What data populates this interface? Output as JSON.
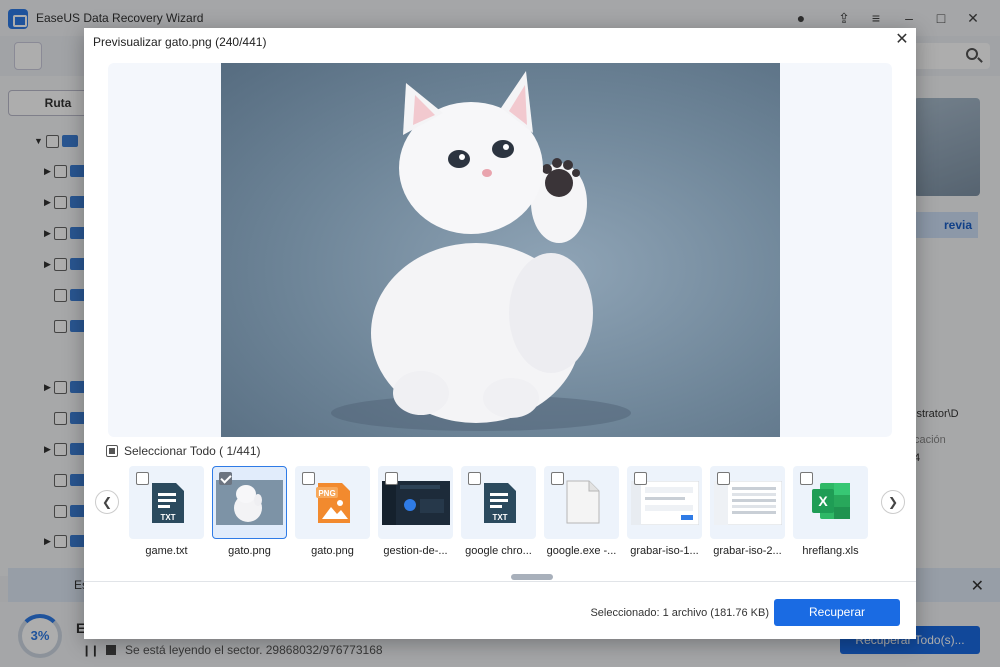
{
  "app": {
    "title": "EaseUS Data Recovery Wizard"
  },
  "background": {
    "ruta_tab": "Ruta",
    "preview_button": "revia",
    "info_path": "istrator\\D",
    "info_location_label": "cación",
    "info_location_value": "4",
    "notice_text": "Es",
    "progress_percent": "3%",
    "status_initial": "E",
    "sector_status": "Se está leyendo el sector. 29868032/976773168",
    "recover_all": "Recuperar Todo(s)..."
  },
  "modal": {
    "title": "Previsualizar gato.png (240/441)",
    "select_all_label": "Seleccionar Todo ( 1/441)",
    "selected_info": "Seleccionado: 1 archivo (181.76 KB)",
    "recover_button": "Recuperar",
    "files": [
      {
        "name": "game.txt",
        "type": "txt",
        "selected": false
      },
      {
        "name": "gato.png",
        "type": "image",
        "selected": true
      },
      {
        "name": "gato.png",
        "type": "png",
        "selected": false
      },
      {
        "name": "gestion-de-...",
        "type": "screenshot-dark",
        "selected": false
      },
      {
        "name": "google chro...",
        "type": "txt",
        "selected": false
      },
      {
        "name": "google.exe -...",
        "type": "blank",
        "selected": false
      },
      {
        "name": "grabar-iso-1...",
        "type": "screenshot-light",
        "selected": false
      },
      {
        "name": "grabar-iso-2...",
        "type": "screenshot-light2",
        "selected": false
      },
      {
        "name": "hreflang.xls",
        "type": "xls",
        "selected": false
      }
    ]
  },
  "icons": {
    "txt_label": "TXT",
    "png_label": "PNG",
    "xls_label": "X"
  },
  "colors": {
    "accent": "#1a6be3",
    "txt_icon": "#2b4a5e",
    "png_icon": "#f28a2e",
    "xls_icon": "#1f9d55"
  }
}
